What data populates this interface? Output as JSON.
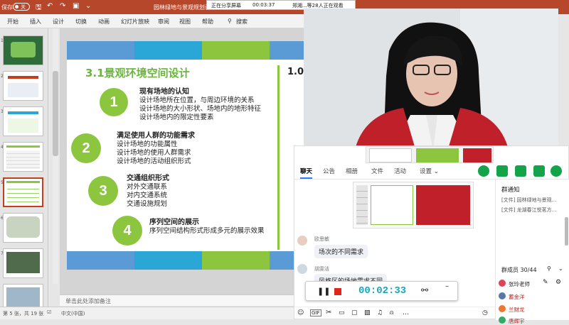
{
  "titlebar": {
    "autosave": "保存",
    "autosave_state": "关",
    "doc_title": "园林绿地与景观规划设计..."
  },
  "share_bar": {
    "sharing": "正在分享屏幕",
    "timer": "00:03:37",
    "viewers": "郑湘...等28人正在观看"
  },
  "ribbon_tabs": [
    "开始",
    "插入",
    "设计",
    "切换",
    "动画",
    "幻灯片放映",
    "审阅",
    "视图",
    "帮助"
  ],
  "ribbon_search": "搜索",
  "thumbnails": {
    "numbers": [
      "1",
      "2",
      "3",
      "4",
      "5",
      "6",
      "7"
    ],
    "selected_index": 4
  },
  "slide": {
    "title": "3.1景观环境空间设计",
    "corner_text": "1.0",
    "bar_colors": [
      "#5b9bd5",
      "#2aa7d6",
      "#8cc63f",
      "#5b9bd5",
      "#2aa7d6"
    ],
    "sections": [
      {
        "num": "1",
        "heading": "现有场地的认知",
        "lines": [
          "设计场地所在位置，与周边环境的关系",
          "设计场地的大小形状、场地内的地形特征",
          "设计场地内的限定性要素"
        ]
      },
      {
        "num": "2",
        "heading": "满足使用人群的功能需求",
        "lines": [
          "设计场地的功能属性",
          "设计场地的使用人群需求",
          "设计场地的活动组织形式"
        ]
      },
      {
        "num": "3",
        "heading": "交通组织形式",
        "lines": [
          "对外交通联系",
          "对内交通系统",
          "交通设施规划"
        ]
      },
      {
        "num": "4",
        "heading": "序列空间的展示",
        "lines": [
          "序列空间结构形式形成多元的展示效果"
        ]
      }
    ]
  },
  "notes_placeholder": "单击此处添加备注",
  "status": {
    "slide_info": "第 5 张，共 19 张",
    "language": "中文(中国)"
  },
  "chat": {
    "tabs": [
      "聊天",
      "公告",
      "相册",
      "文件",
      "活动",
      "设置 ⌄"
    ],
    "active_tab": "聊天",
    "messages": [
      {
        "sender": "欧思敏",
        "text": "场次的不同需求"
      },
      {
        "sender": "胡雯洁",
        "text": "风格区的场地需求不同"
      }
    ],
    "notice_title": "群通知",
    "files": [
      "[文件] 园林绿地与景观...",
      "[文件] 龙湖春江悦茗方..."
    ],
    "members_label": "群成员 30/44",
    "members": [
      "张玲老师",
      "蓄金洋",
      "兰财龙",
      "唐辉宇"
    ],
    "recording_time": "00:02:33"
  },
  "colors": {
    "ppt_red": "#b7472a",
    "slide_green": "#8cc63f",
    "slide_green_title": "#6cb33f",
    "qq_green": "#14a348",
    "rec_teal": "#1aa6b7"
  }
}
